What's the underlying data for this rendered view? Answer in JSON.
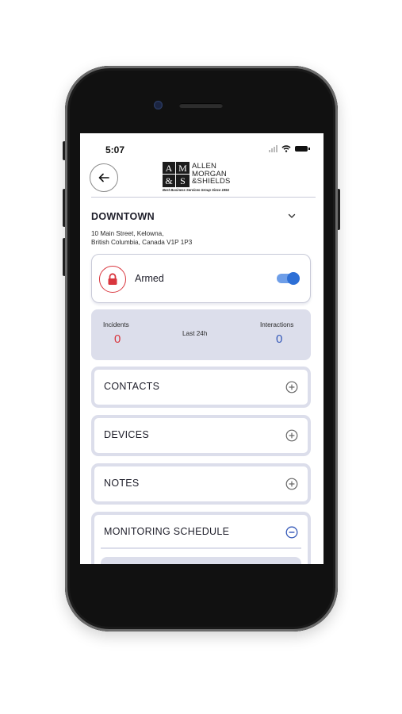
{
  "status_bar": {
    "time": "5:07"
  },
  "logo": {
    "mark_top": "AM",
    "mark_bottom": "&S",
    "name_line1": "ALLEN",
    "name_line2": "MORGAN",
    "name_line3": "&SHIELDS",
    "tagline": "Best Business Services Group Since 1994"
  },
  "location": {
    "title": "DOWNTOWN",
    "address_line1": "10 Main Street, Kelowna,",
    "address_line2": "British Columbia, Canada V1P 1P3"
  },
  "arm_status": {
    "label": "Armed",
    "toggle_on": true
  },
  "stats": {
    "incidents_label": "Incidents",
    "incidents_value": "0",
    "period_label": "Last 24h",
    "interactions_label": "Interactions",
    "interactions_value": "0"
  },
  "sections": {
    "contacts": "CONTACTS",
    "devices": "DEVICES",
    "notes": "NOTES",
    "monitoring_schedule": "MONITORING SCHEDULE"
  },
  "colors": {
    "accent_blue": "#2d6fd6",
    "alert_red": "#d9363e",
    "panel_bg": "#dcdeeb",
    "interactions_blue": "#3559b8"
  },
  "icons": {
    "back": "back-arrow-icon",
    "chevron": "chevron-down-icon",
    "lock": "lock-icon",
    "expand": "plus-circle-icon",
    "collapse": "minus-circle-icon"
  }
}
